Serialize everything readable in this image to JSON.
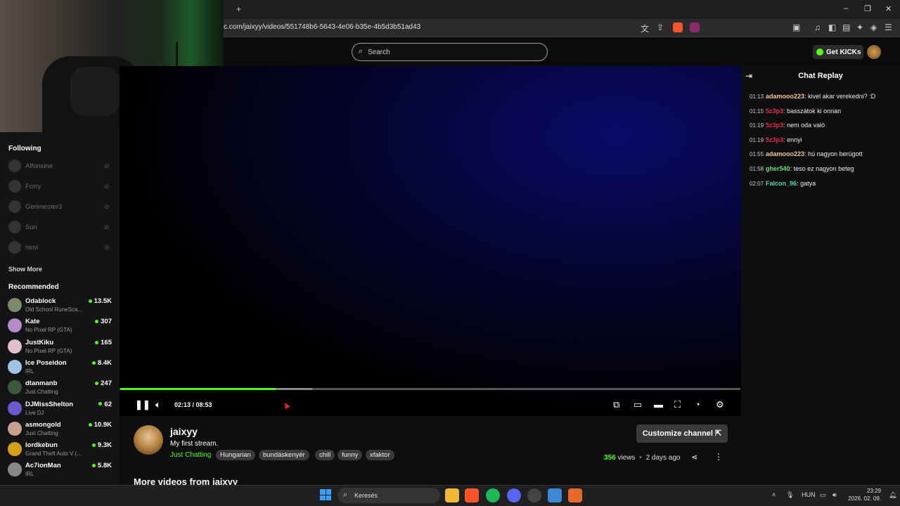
{
  "browser": {
    "new_tab": "+",
    "url": "c.com/jaixyy/videos/551748b6-5643-4e06-b35e-4b5d3b51ad43",
    "window_buttons": [
      "–",
      "❐",
      "✕"
    ]
  },
  "header": {
    "search_placeholder": "Search",
    "get_kicks": "Get KICKs"
  },
  "sidebar": {
    "following_title": "Following",
    "following": [
      {
        "name": "Alfonsine"
      },
      {
        "name": "Forry"
      },
      {
        "name": "Gerimester3"
      },
      {
        "name": "Suri"
      },
      {
        "name": "html"
      }
    ],
    "show_more": "Show More",
    "recommended_title": "Recommended",
    "recommended": [
      {
        "name": "Odablock",
        "category": "Old School RuneSca...",
        "viewers": "13.5K",
        "color": "#7a8a6a"
      },
      {
        "name": "Kate",
        "category": "No Pixel RP (GTA)",
        "viewers": "307",
        "color": "#b58ac9"
      },
      {
        "name": "JustKiku",
        "category": "No Pixel RP (GTA)",
        "viewers": "165",
        "color": "#e0c0d0"
      },
      {
        "name": "Ice Poseidon",
        "category": "IRL",
        "viewers": "8.4K",
        "color": "#9fc4e6"
      },
      {
        "name": "dtanmanb",
        "category": "Just Chatting",
        "viewers": "247",
        "color": "#3a5a3a"
      },
      {
        "name": "DJMissShelton",
        "category": "Live DJ",
        "viewers": "62",
        "color": "#6a5acd"
      },
      {
        "name": "asmongold",
        "category": "Just Chatting",
        "viewers": "10.9K",
        "color": "#c8a090"
      },
      {
        "name": "lordkebun",
        "category": "Grand Theft Auto V (...",
        "viewers": "9.3K",
        "color": "#d4a017"
      },
      {
        "name": "Ac7ionMan",
        "category": "IRL",
        "viewers": "5.8K",
        "color": "#888888"
      }
    ]
  },
  "player": {
    "time": "02:13 / 08:53",
    "progress": 0.25,
    "buffered": 0.31
  },
  "video": {
    "channel": "jaixyy",
    "title": "My first stream.",
    "category": "Just Chatting",
    "tags": [
      "Hungarian",
      "bundáskenyér",
      "chill",
      "funny",
      "xfaktor"
    ],
    "customize": "Customize channel",
    "views_count": "356",
    "views_label": "views",
    "age": "2 days ago",
    "more_videos": "More videos from jaixyy"
  },
  "chat": {
    "title": "Chat Replay",
    "messages": [
      {
        "time": "01:13",
        "user": "adamooo223",
        "color": "#f5c88c",
        "text": "kivel akar verekedni? :D"
      },
      {
        "time": "01:15",
        "user": "5z3p3",
        "color": "#e0314b",
        "text": "basszátok ki onnan"
      },
      {
        "time": "01:19",
        "user": "5z3p3",
        "color": "#e0314b",
        "text": "nem oda való"
      },
      {
        "time": "01:19",
        "user": "5z3p3",
        "color": "#e0314b",
        "text": "ennyi"
      },
      {
        "time": "01:55",
        "user": "adamooo223",
        "color": "#f5c88c",
        "text": "hú nagyon berúgott"
      },
      {
        "time": "01:58",
        "user": "gher540",
        "color": "#6ee07a",
        "text": "teso ez nagyon beteg"
      },
      {
        "time": "02:07",
        "user": "Falcon_96",
        "color": "#4fd6a8",
        "text": "gatya"
      }
    ]
  },
  "taskbar": {
    "search": "Keresés",
    "lang": "HUN",
    "time": "23:29",
    "date": "2026. 02. 09."
  }
}
